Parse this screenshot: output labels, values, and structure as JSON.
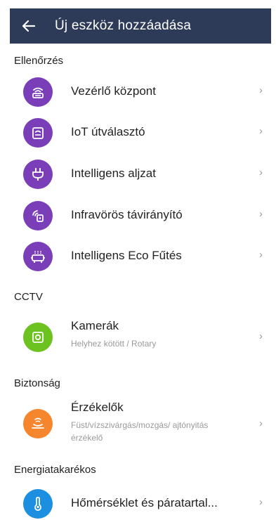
{
  "header": {
    "title": "Új eszköz hozzáadása",
    "back_icon": "arrow-left-icon"
  },
  "colors": {
    "appbar": "#2d3a58",
    "purple": "#7a3fb8",
    "green": "#6cc21e",
    "orange": "#f5862e",
    "blue": "#1d8fe0"
  },
  "sections": {
    "ellenorzes": "Ellenőrzés",
    "cctv": "CCTV",
    "biztonsag": "Biztonság",
    "energia": "Energiatakarékos"
  },
  "items": {
    "vezerlo": {
      "label": "Vezérlő központ",
      "icon": "gateway-icon"
    },
    "iot": {
      "label": "IoT útválasztó",
      "icon": "router-icon"
    },
    "aljzat": {
      "label": "Intelligens aljzat",
      "icon": "plug-icon"
    },
    "infra": {
      "label": "Infravörös távirányító",
      "icon": "ir-remote-icon"
    },
    "futes": {
      "label": "Intelligens Eco Fűtés",
      "icon": "heater-icon"
    },
    "kamerak": {
      "label": "Kamerák",
      "sub": "Helyhez kötött / Rotary",
      "icon": "camera-icon"
    },
    "erzekelok": {
      "label": "Érzékelők",
      "sub": "Füst/vízszivárgás/mozgás/ ajtónyitás érzékelő",
      "icon": "sensor-icon"
    },
    "homerseklet": {
      "label": "Hőmérséklet és páratartal...",
      "icon": "thermometer-icon"
    }
  },
  "chevron": "›"
}
